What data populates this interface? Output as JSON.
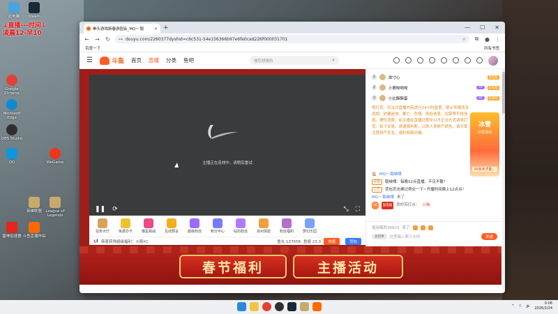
{
  "desktop": {
    "live_note_line1": "↓直播---时间↓",
    "live_note_line2": "凌晨12-早10",
    "icons": [
      {
        "label": "此电脑",
        "color": "#4aa3df"
      },
      {
        "label": "Steam",
        "color": "#1b2838"
      },
      {
        "label": "Google Chrome",
        "color": "#e34133"
      },
      {
        "label": "Microsoft Edge",
        "color": "#0f8bd0"
      },
      {
        "label": "OBS Studio",
        "color": "#302e31"
      },
      {
        "label": "QQ",
        "color": "#1296db"
      },
      {
        "label": "WeGame",
        "color": "#f1341c"
      },
      {
        "label": "英雄联盟",
        "color": "#c8aa6e"
      },
      {
        "label": "League of Legends",
        "color": "#c8aa6e"
      },
      {
        "label": "雷神加速器",
        "color": "#e2261c"
      },
      {
        "label": "斗鱼直播伴侣",
        "color": "#ff6a00"
      }
    ]
  },
  "browser": {
    "tab_title": "拳头游戏新春游园会_MQ~ 毅",
    "url": "douyu.com/2260377dyshid=c6c531-54e156366b97e6fe0cad226f000031701",
    "bookmark": "百度一下",
    "bookmark_right": "所有书签"
  },
  "douyu": {
    "nav": [
      "首页",
      "直播",
      "分类",
      "鱼吧"
    ],
    "search_placeholder": "搜您想搜的",
    "player_message": "主播正在连线中，请稍后重试",
    "gifts": [
      {
        "label": "任务大厅",
        "color": "#d9a15a"
      },
      {
        "label": "免费办卡",
        "color": "#f0c030"
      },
      {
        "label": "爆星挑战",
        "color": "#e84a8a"
      },
      {
        "label": "互动预言",
        "color": "#f0b020"
      },
      {
        "label": "超级粉丝",
        "color": "#9b6bff"
      },
      {
        "label": "积分中心",
        "color": "#7a7aff"
      },
      {
        "label": "钻石粉丝",
        "color": "#b07aff"
      },
      {
        "label": "派对体验",
        "color": "#f0a040"
      },
      {
        "label": "粉丝福利",
        "color": "#b070d0"
      },
      {
        "label": "梦幻乐园",
        "color": "#7aa0ff"
      }
    ],
    "status_left": "恭喜获得超级福利：火箭X1",
    "fish_balls": "鱼丸 137658",
    "fish_wings": "鱼翅 23.3",
    "charge_label": "充值",
    "bag_label": "背包",
    "banner_left": "春节福利",
    "banner_right": "主播活动",
    "rank": [
      {
        "num": "1",
        "name": "欲寸心",
        "level": "",
        "fan": "猫猫猫"
      },
      {
        "num": "2",
        "name": "小鹿呦呦呦",
        "level": "30",
        "fan": "猫猫猫"
      },
      {
        "num": "3",
        "name": "小比酥酥蛋",
        "level": "28",
        "fan": "猫猫猫"
      }
    ],
    "notice": "规打赏、负法对直播内容进行24小时监督，禁止传播违法违规、封建迷信、暴力、色情、低俗信息、拉踩等不良信息。理性消费，如主播在直播过程中以不正当方式诱导打赏、私下交易，请谨慎判断，以防人身财产损失。请大家注意财产安全，谨防网络诈骗。",
    "notice_line_tail": "线币等广告诱导，谨防网络诈骗。",
    "side_activity_title": "冰雪",
    "side_activity_sub": "冰雪活动",
    "side_activity_cta": "20多天才能…",
    "room_line": "MQ~ 毅峡噗",
    "title_tag": "标题",
    "title_text": "毅峡噗：每晚12点直播，不见不散！",
    "notice_tag": "公告",
    "notice_text": "背包页光捧记得交一下~开播时间晚上12点",
    "notice_tail": "点！",
    "sys_user": "MQ~ 毅峡噗",
    "sys_action": "来了",
    "gift_user": "西柠苏打水：",
    "gift_level": "26",
    "gift_badge": "猫猫猫",
    "gift_msg": "入淘",
    "fans_line": "孤叔瘴西36933",
    "fans_action": "来了",
    "chat_tag": "关我事",
    "chat_placeholder": "这里输入聊几句吧",
    "send_label": "发送"
  },
  "taskbar": {
    "time": "0:06",
    "date": "2026/2/24"
  }
}
